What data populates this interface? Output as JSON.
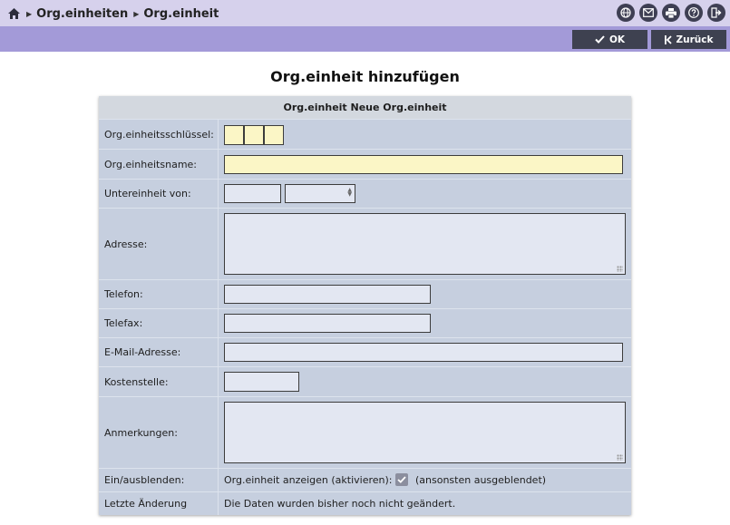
{
  "breadcrumb": {
    "items": [
      "Org.einheiten",
      "Org.einheit"
    ]
  },
  "header_icons": [
    "globe-icon",
    "mail-icon",
    "print-icon",
    "help-icon",
    "logout-icon"
  ],
  "toolbar": {
    "ok_label": "OK",
    "back_label": "Zurück"
  },
  "page": {
    "title": "Org.einheit hinzufügen"
  },
  "form": {
    "header": "Org.einheit Neue Org.einheit",
    "labels": {
      "key": "Org.einheitsschlüssel:",
      "name": "Org.einheitsname:",
      "parent": "Untereinheit von:",
      "address": "Adresse:",
      "phone": "Telefon:",
      "fax": "Telefax:",
      "email": "E-Mail-Adresse:",
      "cost_center": "Kostenstelle:",
      "notes": "Anmerkungen:",
      "visibility": "Ein/ausblenden:",
      "last_change": "Letzte Änderung"
    },
    "values": {
      "key_1": "",
      "key_2": "",
      "key_3": "",
      "name": "",
      "parent_code": "",
      "parent_select": "",
      "address": "",
      "phone": "",
      "fax": "",
      "email": "",
      "cost_center": "",
      "notes": ""
    },
    "visibility": {
      "label": "Org.einheit anzeigen (aktivieren):",
      "checked": true,
      "note": "(ansonsten ausgeblendet)"
    },
    "last_change_text": "Die Daten wurden bisher noch nicht geändert."
  },
  "colors": {
    "topbar": "#d6d1ec",
    "toolbar": "#a39ad8",
    "button": "#3e4150",
    "form_bg": "#c6cfdf",
    "required_field": "#fbf6c6",
    "field": "#e3e7f2"
  }
}
